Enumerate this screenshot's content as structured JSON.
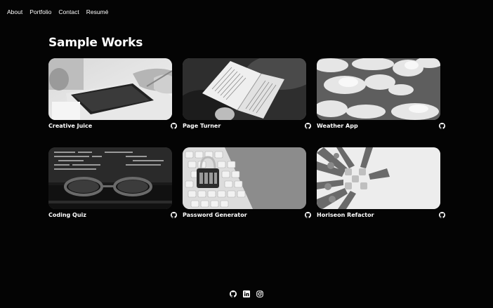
{
  "nav": {
    "items": [
      {
        "label": "About"
      },
      {
        "label": "Portfolio"
      },
      {
        "label": "Contact"
      },
      {
        "label": "Resumé"
      }
    ]
  },
  "main": {
    "title": "Sample Works",
    "projects": [
      {
        "name": "Creative Juice",
        "image_icon": "tablet-writing-photo",
        "link_icon": "github-icon"
      },
      {
        "name": "Page Turner",
        "image_icon": "open-book-photo",
        "link_icon": "github-icon"
      },
      {
        "name": "Weather App",
        "image_icon": "clouds-sky-photo",
        "link_icon": "github-icon"
      },
      {
        "name": "Coding Quiz",
        "image_icon": "glasses-code-screen-photo",
        "link_icon": "github-icon"
      },
      {
        "name": "Password Generator",
        "image_icon": "padlock-keyboard-photo",
        "link_icon": "github-icon"
      },
      {
        "name": "Horiseon Refactor",
        "image_icon": "puzzle-hands-photo",
        "link_icon": "github-icon"
      }
    ]
  },
  "footer": {
    "icons": [
      "github-icon",
      "linkedin-icon",
      "instagram-icon"
    ]
  },
  "colors": {
    "background": "#040404",
    "text": "#ffffff"
  }
}
